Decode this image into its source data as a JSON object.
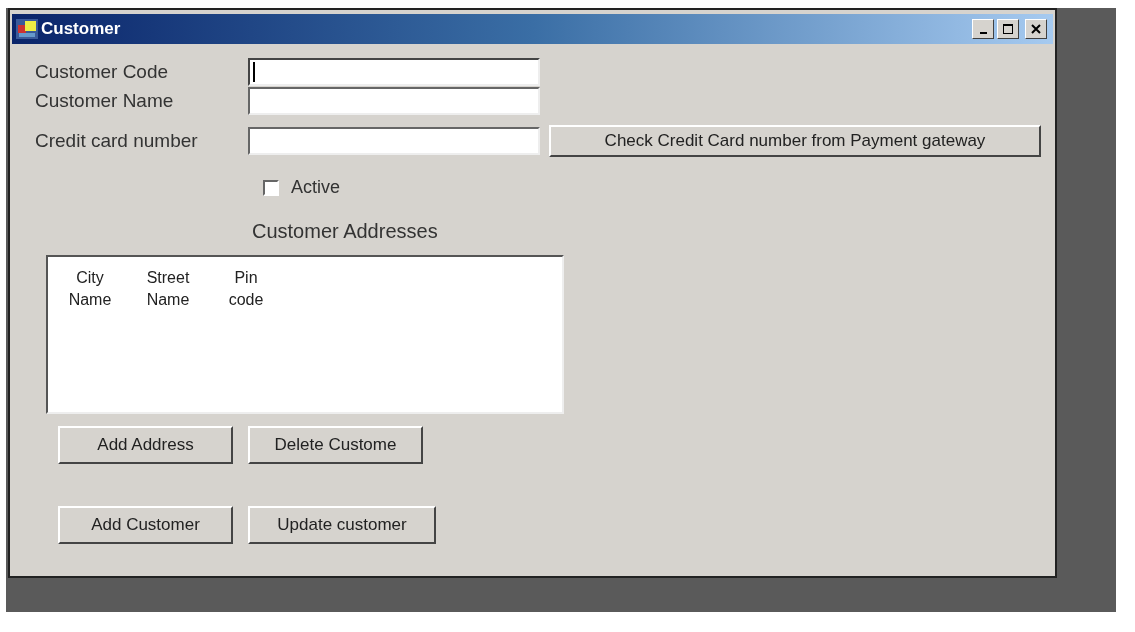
{
  "window": {
    "title": "Customer"
  },
  "fields": [
    {
      "label": "Customer Code",
      "focused": true
    },
    {
      "label": "Customer Name",
      "focused": false
    },
    {
      "label": "Credit card number",
      "focused": false
    }
  ],
  "check_button": "Check Credit Card number from Payment gateway",
  "active_checkbox": {
    "label": "Active",
    "checked": false
  },
  "addresses": {
    "title": "Customer Addresses",
    "columns": [
      "City Name",
      "Street Name",
      "Pin code"
    ]
  },
  "address_buttons": [
    "Add Address",
    "Delete Custome"
  ],
  "customer_buttons": [
    "Add Customer",
    "Update customer"
  ]
}
